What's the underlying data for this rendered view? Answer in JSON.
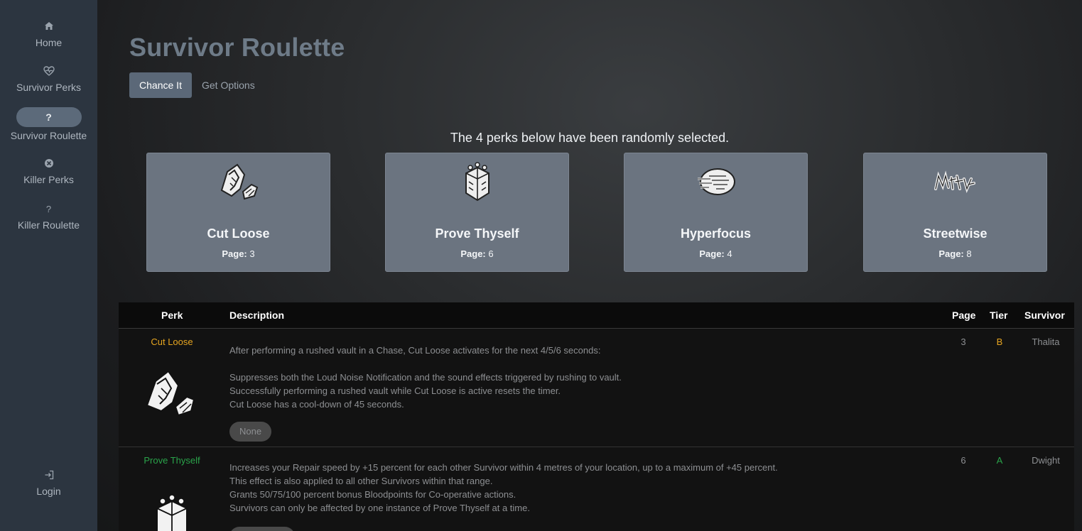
{
  "sidebar": {
    "items": [
      {
        "label": "Home",
        "icon": "home-icon"
      },
      {
        "label": "Survivor Perks",
        "icon": "heartbeat-icon"
      },
      {
        "label": "Survivor Roulette",
        "icon": "question-icon",
        "glyph": "?"
      },
      {
        "label": "Killer Perks",
        "icon": "skull-icon"
      },
      {
        "label": "Killer Roulette",
        "icon": "question-icon",
        "glyph": "?"
      }
    ],
    "login": {
      "label": "Login",
      "icon": "login-icon"
    }
  },
  "header": {
    "title": "Survivor Roulette",
    "chance_label": "Chance It",
    "options_label": "Get Options"
  },
  "selection_message": "The 4 perks below have been randomly selected.",
  "cards": [
    {
      "name": "Cut Loose",
      "page_label": "Page:",
      "page": "3"
    },
    {
      "name": "Prove Thyself",
      "page_label": "Page:",
      "page": "6"
    },
    {
      "name": "Hyperfocus",
      "page_label": "Page:",
      "page": "4"
    },
    {
      "name": "Streetwise",
      "page_label": "Page:",
      "page": "8"
    }
  ],
  "table": {
    "headers": {
      "perk": "Perk",
      "description": "Description",
      "page": "Page",
      "tier": "Tier",
      "survivor": "Survivor"
    },
    "rows": [
      {
        "perk": "Cut Loose",
        "perk_color": "#e6a520",
        "description": "After performing a rushed vault in a Chase, Cut Loose activates for the next 4/5/6 seconds:\n\nSuppresses both the Loud Noise Notification and the sound effects triggered by rushing to vault.\nSuccessfully performing a rushed vault while Cut Loose is active resets the timer.\nCut Loose has a cool-down of 45 seconds.",
        "tag": "None",
        "page": "3",
        "tier": "B",
        "tier_color": "#e6a520",
        "survivor": "Thalita"
      },
      {
        "perk": "Prove Thyself",
        "perk_color": "#2aa34a",
        "description": "Increases your Repair speed by +15 percent for each other Survivor within 4 metres of your location, up to a maximum of +45 percent.\nThis effect is also applied to all other Survivors within that range.\nGrants 50/75/100 percent bonus Bloodpoints for Co-operative actions.\nSurvivors can only be affected by one instance of Prove Thyself at a time.",
        "tag": "",
        "page": "6",
        "tier": "A",
        "tier_color": "#2aa34a",
        "survivor": "Dwight"
      }
    ]
  }
}
